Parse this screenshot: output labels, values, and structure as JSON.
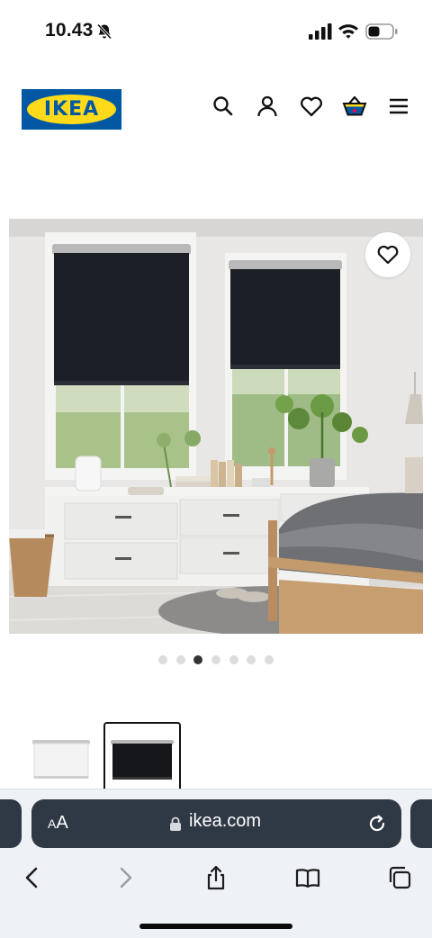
{
  "status_bar": {
    "time": "10.43",
    "icons": [
      "bell-slash-icon",
      "cellular-signal-icon",
      "wifi-icon",
      "battery-icon"
    ]
  },
  "header": {
    "logo_text": "IKEA",
    "brand_colors": {
      "blue": "#0058a3",
      "yellow": "#ffda1a"
    },
    "icons": [
      "search-icon",
      "profile-icon",
      "heart-icon",
      "shopping-basket-icon",
      "menu-icon"
    ]
  },
  "product": {
    "image": "roller-blind-bedroom-photo",
    "favorite_icon": "heart-outline-icon",
    "carousel": {
      "total": 7,
      "active_index": 2
    },
    "thumbnails": [
      {
        "name": "white-blind-thumbnail",
        "selected": false
      },
      {
        "name": "black-blind-thumbnail",
        "selected": true
      }
    ]
  },
  "browser": {
    "text_size_label": "AA",
    "url": "ikea.com",
    "buttons": [
      "back-icon",
      "forward-icon",
      "share-icon",
      "bookmarks-icon",
      "tabs-icon"
    ],
    "bar_color": "#2f3845"
  }
}
